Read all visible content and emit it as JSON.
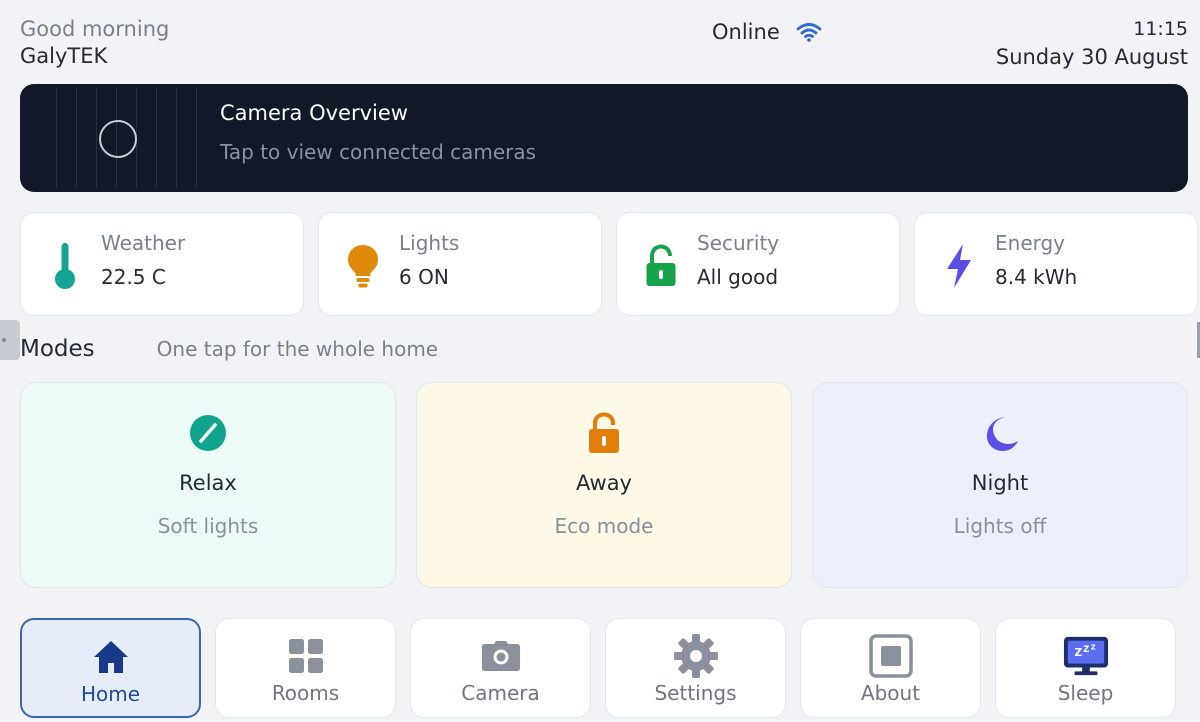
{
  "header": {
    "greeting": "Good morning",
    "user": "GalyTEK",
    "connection": "Online",
    "time": "11:15",
    "date": "Sunday 30 August"
  },
  "camera": {
    "title": "Camera Overview",
    "hint": "Tap to view connected cameras"
  },
  "stats": [
    {
      "label": "Weather",
      "value": "22.5 C",
      "icon": "thermometer-icon",
      "color": "#16a394"
    },
    {
      "label": "Lights",
      "value": "6 ON",
      "icon": "lightbulb-icon",
      "color": "#e08a0b"
    },
    {
      "label": "Security",
      "value": "All good",
      "icon": "lock-icon",
      "color": "#17a34a"
    },
    {
      "label": "Energy",
      "value": "8.4 kWh",
      "icon": "lightning-icon",
      "color": "#5b4ee6"
    }
  ],
  "modes": {
    "heading": "Modes",
    "subheading": "One tap for the whole home",
    "items": [
      {
        "name": "Relax",
        "desc": "Soft lights",
        "icon": "relax-icon",
        "color": "#10a38e"
      },
      {
        "name": "Away",
        "desc": "Eco mode",
        "icon": "unlock-icon",
        "color": "#e27d0c"
      },
      {
        "name": "Night",
        "desc": "Lights off",
        "icon": "moon-icon",
        "color": "#5b4ee6"
      }
    ]
  },
  "nav": [
    {
      "label": "Home",
      "icon": "home-icon",
      "active": true
    },
    {
      "label": "Rooms",
      "icon": "grid-icon"
    },
    {
      "label": "Camera",
      "icon": "camera-icon"
    },
    {
      "label": "Settings",
      "icon": "gear-icon"
    },
    {
      "label": "About",
      "icon": "about-icon"
    },
    {
      "label": "Sleep",
      "icon": "sleep-monitor-icon"
    }
  ]
}
